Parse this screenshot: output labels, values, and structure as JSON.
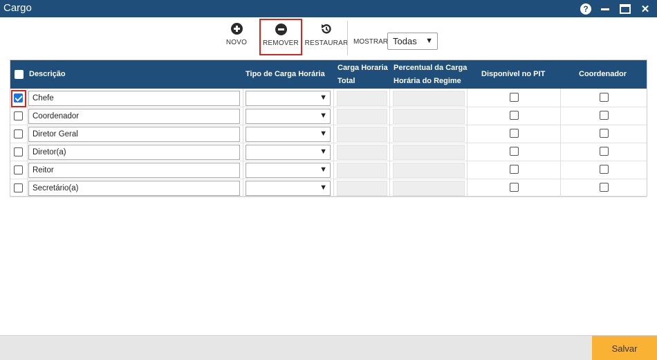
{
  "window": {
    "title": "Cargo",
    "help_label": "?",
    "close_label": "✕"
  },
  "toolbar": {
    "novo_label": "NOVO",
    "remover_label": "REMOVER",
    "restaurar_label": "RESTAURAR",
    "mostrar_label": "MOSTRAR:",
    "mostrar_value": "Todas"
  },
  "table": {
    "headers": {
      "descricao": "Descrição",
      "tipo": "Tipo de Carga Horária",
      "carga_l1": "Carga Horaria",
      "carga_l2": "Total",
      "percentual_l1": "Percentual da Carga",
      "percentual_l2": "Horária do Regime",
      "disponivel": "Disponível no PIT",
      "coordenador": "Coordenador"
    },
    "rows": [
      {
        "selected": true,
        "descricao": "Chefe",
        "tipo": "",
        "disponivel": false,
        "coordenador": false
      },
      {
        "selected": false,
        "descricao": "Coordenador",
        "tipo": "",
        "disponivel": false,
        "coordenador": false
      },
      {
        "selected": false,
        "descricao": "Diretor Geral",
        "tipo": "",
        "disponivel": false,
        "coordenador": false
      },
      {
        "selected": false,
        "descricao": "Diretor(a)",
        "tipo": "",
        "disponivel": false,
        "coordenador": false
      },
      {
        "selected": false,
        "descricao": "Reitor",
        "tipo": "",
        "disponivel": false,
        "coordenador": false
      },
      {
        "selected": false,
        "descricao": "Secretário(a)",
        "tipo": "",
        "disponivel": false,
        "coordenador": false
      }
    ]
  },
  "footer": {
    "save_label": "Salvar"
  },
  "colors": {
    "header_bg": "#1e4e79",
    "highlight": "#d9241c",
    "save_bg": "#f9b233",
    "checkbox_checked": "#1a73e8"
  }
}
